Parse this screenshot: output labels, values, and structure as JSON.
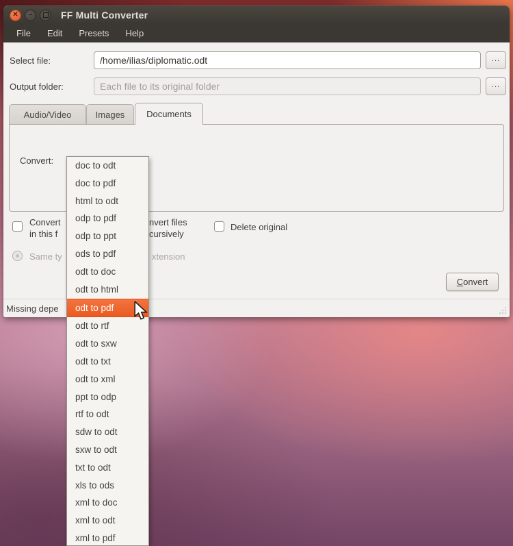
{
  "window": {
    "title": "FF Multi Converter",
    "icons": {
      "close": "✕",
      "minimize": "–",
      "maximize": "▢"
    }
  },
  "menubar": {
    "items": [
      "File",
      "Edit",
      "Presets",
      "Help"
    ]
  },
  "file_row": {
    "label": "Select file:",
    "value": "/home/ilias/diplomatic.odt",
    "browse": "..."
  },
  "output_row": {
    "label": "Output folder:",
    "placeholder": "Each file to its original folder",
    "browse": "..."
  },
  "tabs": {
    "items": [
      "Audio/Video",
      "Images",
      "Documents"
    ],
    "active_index": 2
  },
  "panel": {
    "convert_label": "Convert:"
  },
  "dropdown": {
    "items": [
      "doc to odt",
      "doc to pdf",
      "html to odt",
      "odp to pdf",
      "odp to ppt",
      "ods to pdf",
      "odt to doc",
      "odt to html",
      "odt to pdf",
      "odt to rtf",
      "odt to sxw",
      "odt to txt",
      "odt to xml",
      "ppt to odp",
      "rtf to odt",
      "sdw to odt",
      "sxw to odt",
      "txt to odt",
      "xls to ods",
      "xml to doc",
      "xml to odt",
      "xml to pdf"
    ],
    "selected_index": 8,
    "selected_value": "odt to pdf"
  },
  "options": {
    "convert_all_line1": "Convert",
    "convert_all_line2": "in this f",
    "recursive_line1": "nvert files",
    "recursive_line2": "cursively",
    "delete_original": "Delete original",
    "same_type": "Same ty",
    "extension_fragment": "xtension"
  },
  "actions": {
    "convert_initial": "C",
    "convert_rest": "onvert"
  },
  "statusbar": {
    "text": "Missing depe"
  },
  "colors": {
    "accent_orange": "#ea5a20",
    "titlebar": "#3b3733",
    "panel_bg": "#f2f1f0",
    "wallpaper_top_right": "#ec784c",
    "wallpaper_bottom": "#744566"
  }
}
